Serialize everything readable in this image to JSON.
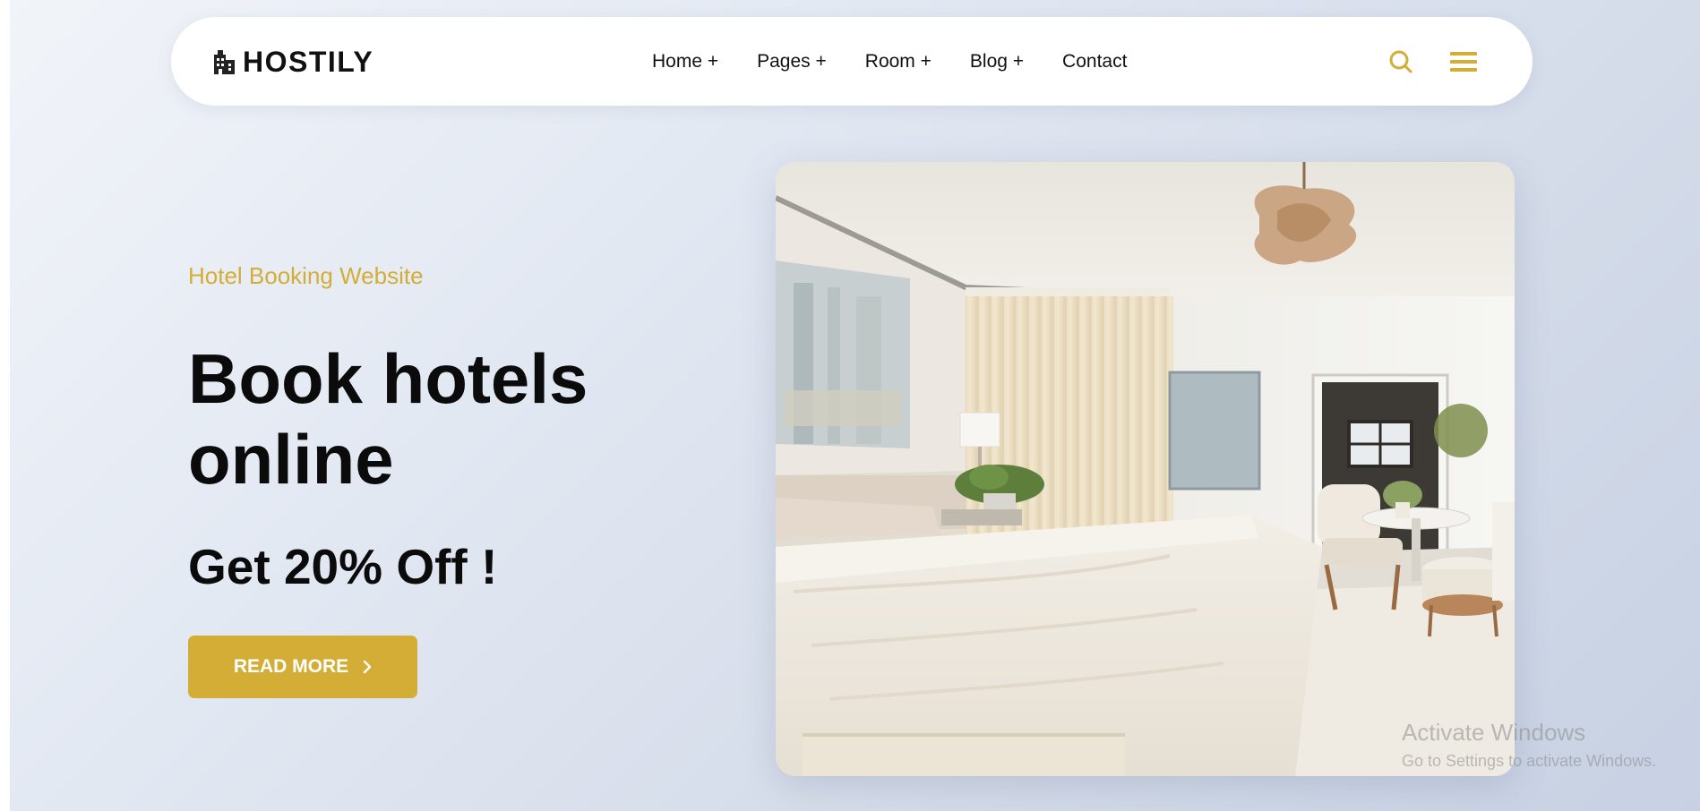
{
  "brand": {
    "name": "HOSTILY",
    "icon": "building-icon",
    "accent": "#d4ad37"
  },
  "nav": {
    "items": [
      {
        "label": "Home +"
      },
      {
        "label": "Pages +"
      },
      {
        "label": "Room +"
      },
      {
        "label": "Blog +"
      },
      {
        "label": "Contact"
      }
    ],
    "search_icon": "search-icon",
    "menu_icon": "hamburger-menu-icon"
  },
  "hero": {
    "eyebrow": "Hotel Booking Website",
    "title_line1": "Book hotels",
    "title_line2": "online",
    "offer": "Get 20% Off !",
    "cta_label": "READ MORE",
    "cta_icon": "chevron-right-icon",
    "image_subject": "hotel-bedroom-photo"
  },
  "watermark": {
    "title": "Activate Windows",
    "subtitle": "Go to Settings to activate Windows."
  }
}
